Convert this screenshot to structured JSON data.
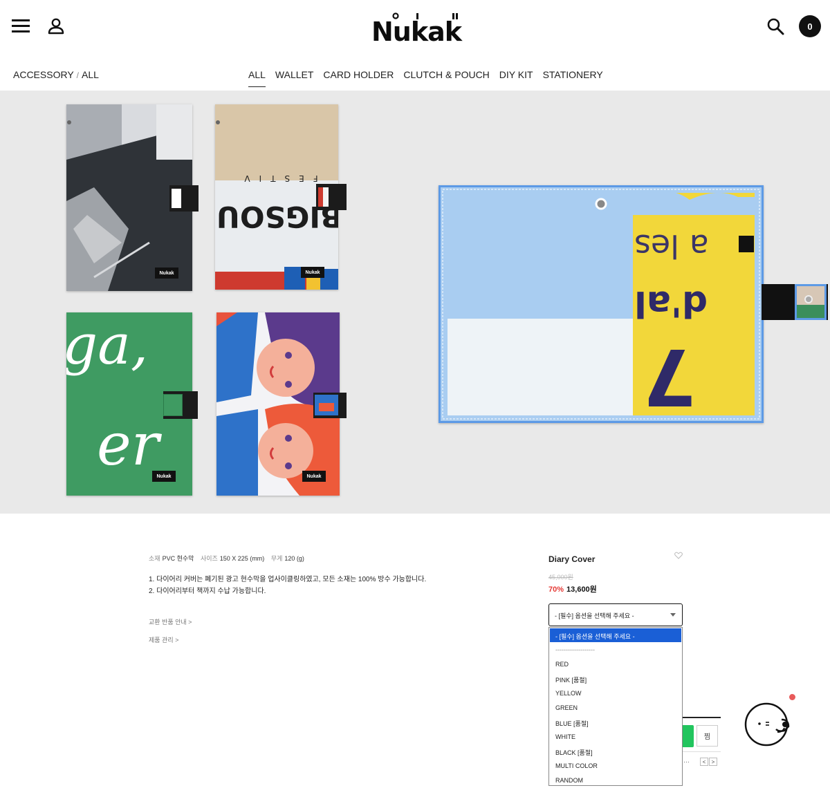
{
  "header": {
    "logo": "Nukak",
    "cart_count": "0"
  },
  "breadcrumb": {
    "parent": "ACCESSORY",
    "separator": "/",
    "current": "ALL"
  },
  "categories": [
    "ALL",
    "WALLET",
    "CARD HOLDER",
    "CLUTCH & POUCH",
    "DIY KIT",
    "STATIONERY"
  ],
  "hero": {
    "tag_label": "Nukak",
    "artwork_text": {
      "festival_top": "FESTIV",
      "festival_mid": "BIGSOUND",
      "green_top": "ga,",
      "green_bottom": "er",
      "yellow_line1": "a les",
      "yellow_line2": "d'al",
      "yellow_num": "7"
    }
  },
  "product": {
    "specs": [
      {
        "key": "소재",
        "value": "PVC 현수막"
      },
      {
        "key": "사이즈",
        "value": "150 X 225 (mm)"
      },
      {
        "key": "무게",
        "value": "120 (g)"
      }
    ],
    "description": [
      "1. 다이어리 커버는 폐기된 광고 현수막을 업사이클링하였고, 모든 소재는 100% 방수 가능합니다.",
      "2. 다이어리부터 책까지 수납 가능합니다."
    ],
    "links": [
      "교환 반품 안내 >",
      "제품 관리 >"
    ],
    "name": "Diary Cover",
    "original_price": "45,000원",
    "discount": "70%",
    "sale_price": "13,600원",
    "select_placeholder": "- [필수] 옵션을 선택해 주세요 -",
    "options": [
      "- [필수] 옵션을 선택해 주세요 -",
      "-------------------",
      "RED",
      "PINK [품절]",
      "YELLOW",
      "GREEN",
      "BLUE [품절]",
      "WHITE",
      "BLACK [품절]",
      "MULTI COLOR",
      "RANDOM"
    ],
    "wish_label": "찜",
    "pager_dots": "…",
    "pager_prev": "<",
    "pager_next": ">"
  },
  "colors": {
    "accent_blue": "#1a5fd6",
    "sale_red": "#e53935",
    "buy_green": "#22c55e",
    "hero_bg": "#e9e9e9"
  },
  "icons": {
    "menu": "hamburger-icon",
    "account": "user-icon",
    "search": "search-icon",
    "wishlist": "heart-icon",
    "chat": "chatbot-icon"
  }
}
